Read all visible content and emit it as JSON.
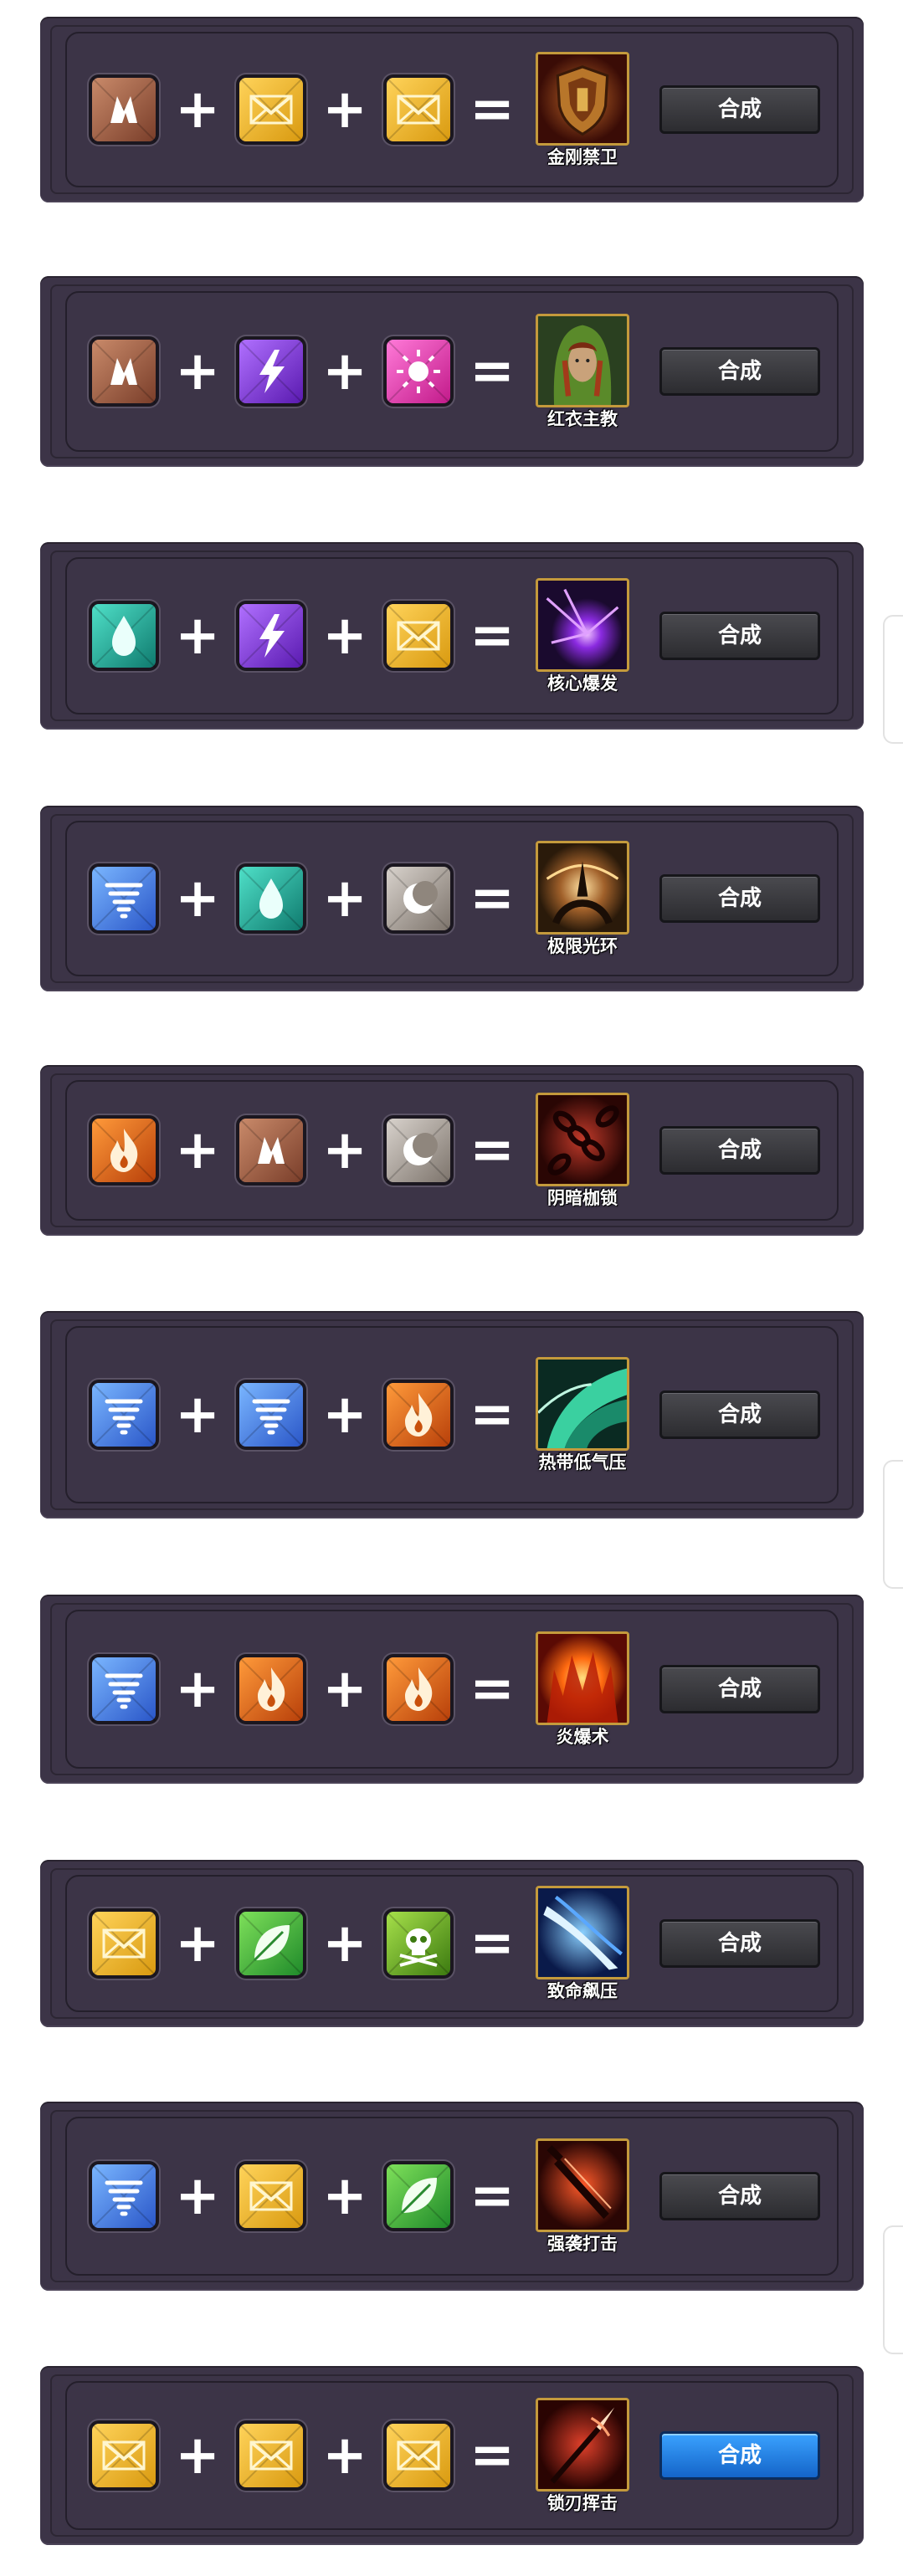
{
  "combine_label": "合成",
  "recipes": [
    {
      "ingredients": [
        "brown-chevron",
        "gold-envelope",
        "gold-envelope"
      ],
      "result": {
        "name": "金刚禁卫",
        "icon": "shield-icon"
      }
    },
    {
      "ingredients": [
        "brown-chevron",
        "purple-lightning",
        "pink-sun"
      ],
      "result": {
        "name": "红衣主教",
        "icon": "hooded-figure-icon"
      }
    },
    {
      "ingredients": [
        "teal-drop",
        "purple-lightning",
        "gold-envelope"
      ],
      "result": {
        "name": "核心爆发",
        "icon": "purple-burst-icon"
      }
    },
    {
      "ingredients": [
        "blue-tornado",
        "teal-drop",
        "gray-crescent"
      ],
      "result": {
        "name": "极限光环",
        "icon": "golden-ring-icon"
      }
    },
    {
      "ingredients": [
        "orange-flame",
        "brown-chevron",
        "gray-crescent"
      ],
      "result": {
        "name": "阴暗枷锁",
        "icon": "chains-icon"
      }
    },
    {
      "ingredients": [
        "blue-tornado",
        "blue-tornado",
        "orange-flame"
      ],
      "result": {
        "name": "热带低气压",
        "icon": "green-wind-icon"
      }
    },
    {
      "ingredients": [
        "blue-tornado",
        "orange-flame",
        "orange-flame"
      ],
      "result": {
        "name": "炎爆术",
        "icon": "fire-burst-icon"
      }
    },
    {
      "ingredients": [
        "gold-envelope",
        "green-leaf",
        "green-skull"
      ],
      "result": {
        "name": "致命飙压",
        "icon": "blue-slash-icon"
      }
    },
    {
      "ingredients": [
        "blue-tornado",
        "gold-envelope",
        "green-leaf"
      ],
      "result": {
        "name": "强袭打击",
        "icon": "red-sword-icon"
      }
    },
    {
      "ingredients": [
        "gold-envelope",
        "gold-envelope",
        "gold-envelope"
      ],
      "result": {
        "name": "锁刃挥击",
        "icon": "red-spear-icon"
      }
    }
  ],
  "active_button_index": 9,
  "colors": {
    "panel": "#3c3447",
    "button_default": "#3a3a3f",
    "button_active": "#1f7ae0",
    "result_border": "#c49a3c"
  }
}
